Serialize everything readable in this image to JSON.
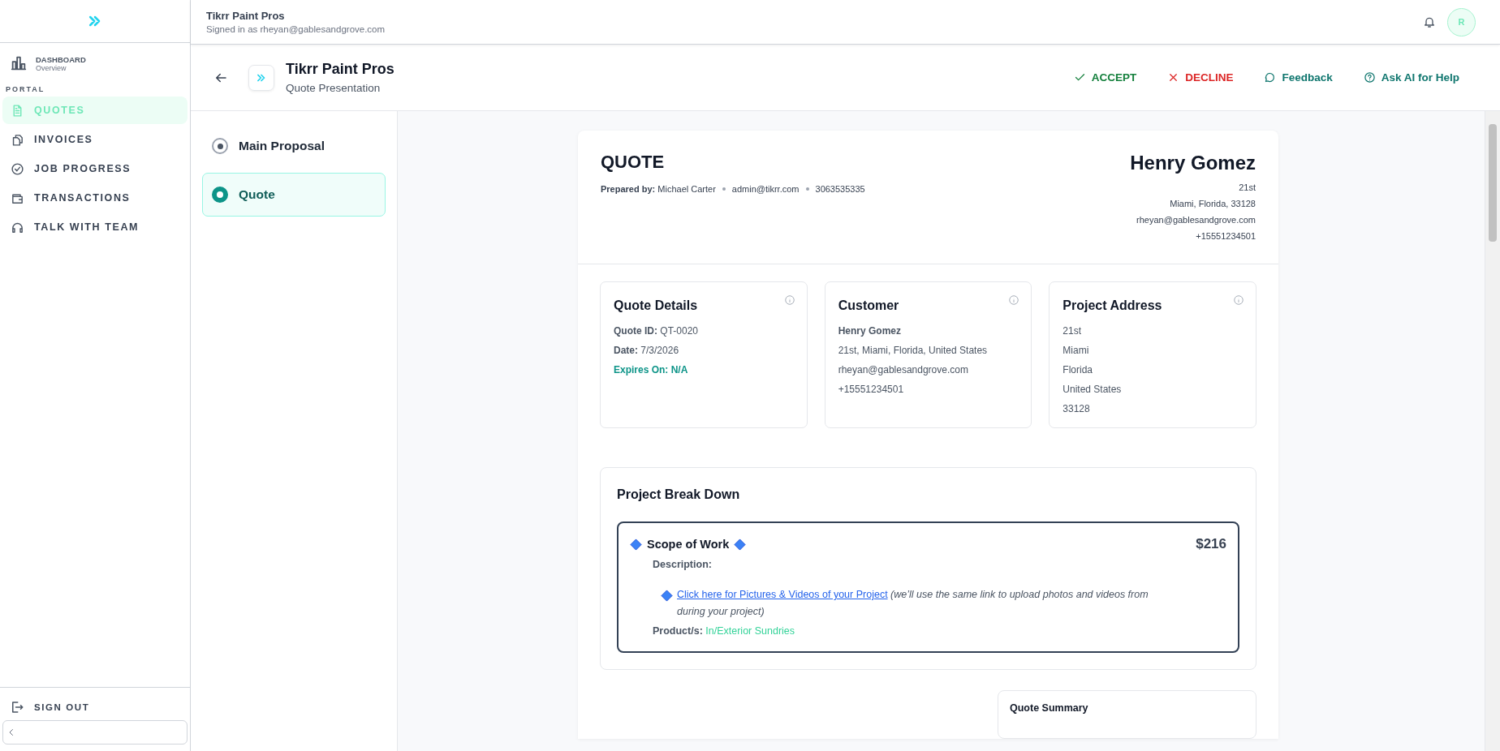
{
  "sidebar": {
    "dashboard": {
      "label": "DASHBOARD",
      "sublabel": "Overview"
    },
    "section_label": "PORTAL",
    "portal_items": [
      {
        "label": "QUOTES",
        "selected": true
      },
      {
        "label": "INVOICES",
        "selected": false
      },
      {
        "label": "JOB PROGRESS",
        "selected": false
      },
      {
        "label": "TRANSACTIONS",
        "selected": false
      },
      {
        "label": "TALK WITH TEAM",
        "selected": false
      }
    ],
    "sign_out": "SIGN OUT"
  },
  "topbar": {
    "title": "Tikrr Paint Pros",
    "subtitle": "Signed in as rheyan@gablesandgrove.com",
    "avatar": "R"
  },
  "page_header": {
    "title": "Tikrr Paint Pros",
    "subtitle": "Quote Presentation",
    "actions": [
      {
        "kind": "accept",
        "label": "ACCEPT"
      },
      {
        "kind": "decline",
        "label": "DECLINE"
      },
      {
        "kind": "feedback",
        "label": "Feedback"
      },
      {
        "kind": "help",
        "label": "Ask AI for Help"
      }
    ]
  },
  "sections": [
    {
      "label": "Main Proposal",
      "selected": false
    },
    {
      "label": "Quote",
      "selected": true
    }
  ],
  "quote": {
    "heading": "QUOTE",
    "prepared_by": "**Prepared by:** Michael Carter",
    "email": "admin@tikrr.com",
    "phone": "3063535335",
    "customer_name": "Henry Gomez",
    "customer_lines": [
      "21st",
      "Miami, Florida, 33128",
      "rheyan@gablesandgrove.com",
      "+15551234501"
    ]
  },
  "info_cards": [
    {
      "title": "Quote Details",
      "lines": [
        {
          "kind": "plain",
          "text": "**Quote ID:** QT-0020"
        },
        {
          "kind": "plain",
          "text": "**Date:** 7/3/2026"
        },
        {
          "kind": "highlight",
          "text": "Expires On: N/A"
        }
      ]
    },
    {
      "title": "Customer",
      "lines": [
        {
          "kind": "strong",
          "text": "Henry Gomez"
        },
        {
          "kind": "plain",
          "text": "21st, Miami, Florida, United States"
        },
        {
          "kind": "plain",
          "text": "rheyan@gablesandgrove.com"
        },
        {
          "kind": "plain",
          "text": "+15551234501"
        }
      ]
    },
    {
      "title": "Project Address",
      "lines": [
        {
          "kind": "plain",
          "text": "21st"
        },
        {
          "kind": "plain",
          "text": "Miami"
        },
        {
          "kind": "plain",
          "text": "Florida"
        },
        {
          "kind": "plain",
          "text": "United States"
        },
        {
          "kind": "plain",
          "text": "33128"
        }
      ]
    }
  ],
  "breakdown": {
    "title": "Project Break Down",
    "items": [
      {
        "title": "Scope of Work",
        "price": "$216",
        "description_label": "Description:",
        "link": "Click here for Pictures & Videos of your Project",
        "note": "(we’ll use the same link to upload photos and videos from during your project)",
        "products_label": "Product/s:",
        "products": "In/Exterior Sundries"
      }
    ]
  },
  "summary": {
    "title": "Quote Summary"
  }
}
